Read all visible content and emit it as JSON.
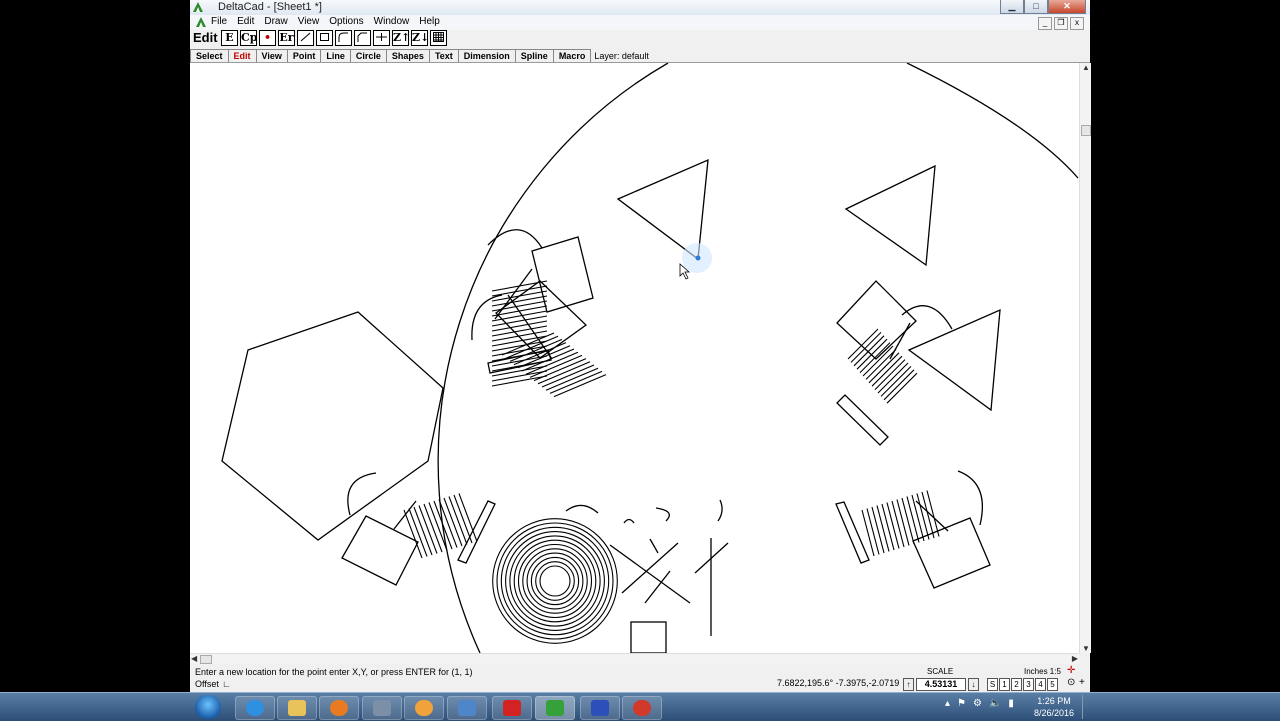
{
  "window": {
    "title": "DeltaCad - [Sheet1 *]"
  },
  "menu": {
    "items": [
      "File",
      "Edit",
      "Draw",
      "View",
      "Options",
      "Window",
      "Help"
    ]
  },
  "toolbar": {
    "mode_label": "Edit",
    "tools": [
      "E",
      "Cp",
      "•",
      "Er",
      "",
      "",
      "",
      "",
      "",
      "Z↑",
      "Z↓",
      ""
    ]
  },
  "tabs": {
    "items": [
      "Select",
      "Edit",
      "View",
      "Point",
      "Line",
      "Circle",
      "Shapes",
      "Text",
      "Dimension",
      "Spline",
      "Macro"
    ],
    "active": "Edit",
    "layer": "Layer: default"
  },
  "status": {
    "prompt": "Enter a new location for the point enter X,Y, or press ENTER for (1, 1)",
    "offset_label": "Offset",
    "coords": "7.6822,195.6°   -7.3975,-2.0719",
    "scale_label": "SCALE",
    "scale_value": "4.53131",
    "units": "Inches 1:5",
    "snaps": [
      "S",
      "1",
      "2",
      "3",
      "4",
      "5"
    ]
  },
  "taskbar": {
    "time": "1:26 PM",
    "date": "8/26/2016"
  },
  "colors": {
    "active_tab": "#c00000",
    "close_button": "#c7462b"
  }
}
